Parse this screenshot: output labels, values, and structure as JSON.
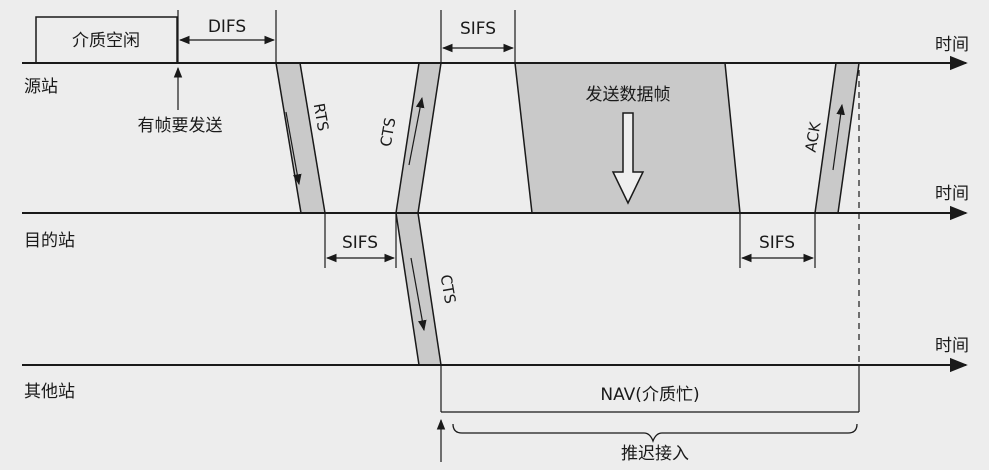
{
  "stations": {
    "source": "源站",
    "destination": "目的站",
    "others": "其他站"
  },
  "time_label": "时间",
  "intervals": {
    "medium_idle": "介质空闲",
    "difs": "DIFS",
    "sifs": "SIFS"
  },
  "annotations": {
    "frame_to_send": "有帧要发送",
    "send_data_frame": "发送数据帧",
    "nav": "NAV(介质忙)",
    "defer_access": "推迟接入"
  },
  "frames": {
    "rts": "RTS",
    "cts": "CTS",
    "ack": "ACK"
  },
  "colors": {
    "background": "#ededed",
    "frame_fill": "#c9c9c9",
    "line": "#1a1a1a"
  }
}
